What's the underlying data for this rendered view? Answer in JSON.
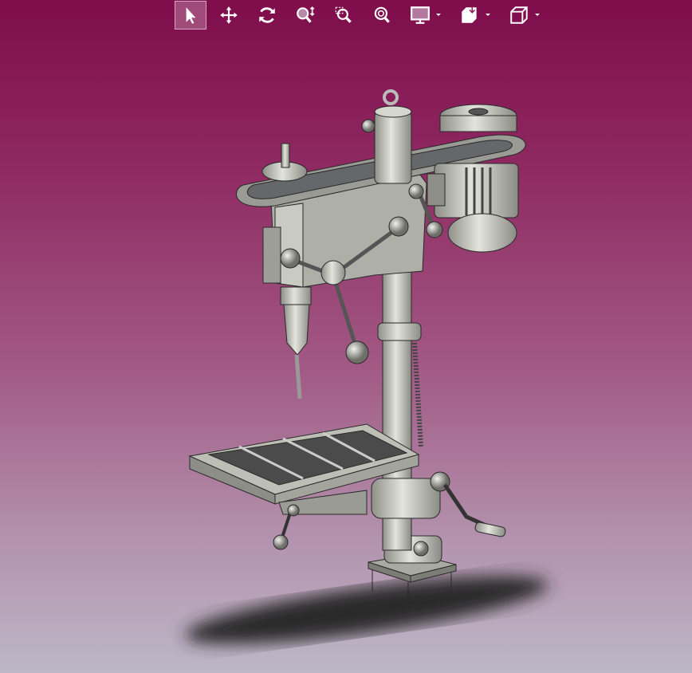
{
  "toolbar": {
    "buttons": [
      {
        "icon": "select-arrow-icon",
        "active": true
      },
      {
        "icon": "pan-icon"
      },
      {
        "icon": "rotate-icon"
      },
      {
        "icon": "zoom-in-out-icon"
      },
      {
        "icon": "zoom-area-icon"
      },
      {
        "icon": "fit-all-icon"
      },
      {
        "icon": "display-mode-icon",
        "dropdown": true
      },
      {
        "icon": "section-view-icon",
        "dropdown": true
      },
      {
        "icon": "view-orientation-cube-icon",
        "dropdown": true
      }
    ]
  },
  "colors": {
    "bg_top": "#7f0c4b",
    "bg_bottom": "#bdb7c7",
    "model": "#b9bab2"
  }
}
